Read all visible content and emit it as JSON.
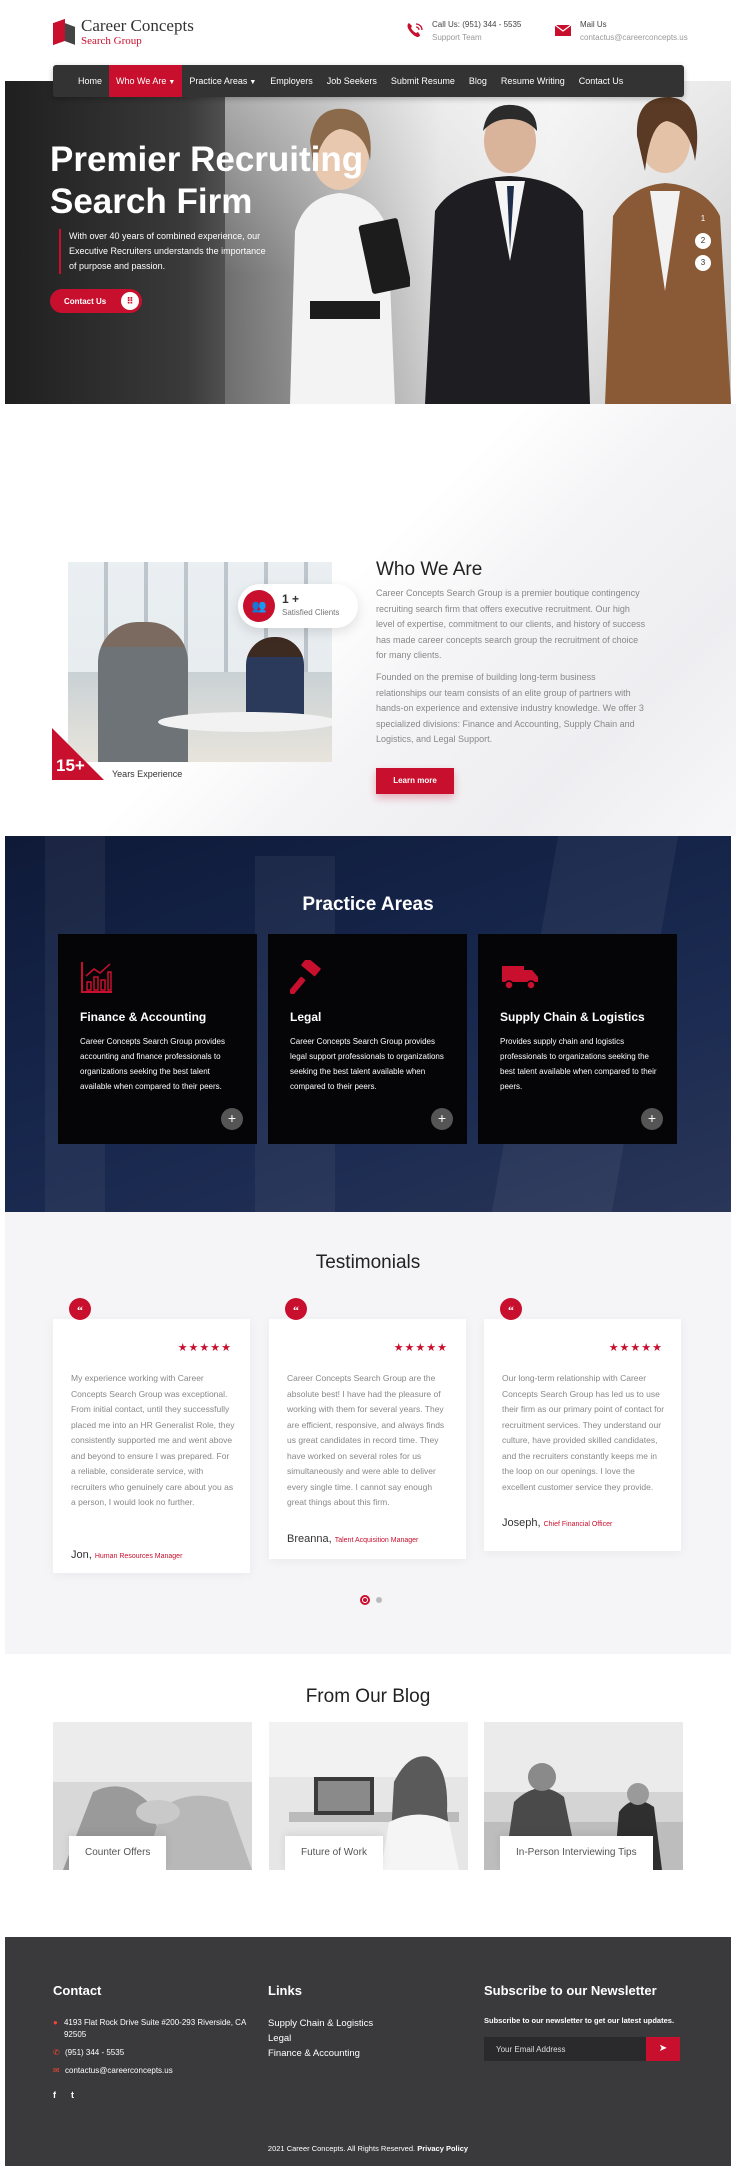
{
  "brand": {
    "name": "Career Concepts",
    "sub": "Search Group",
    "accent_color": "#c8102e",
    "dark_color": "#333333"
  },
  "header": {
    "call_label": "Call Us: (951) 344 - 5535",
    "call_sub": "Support Team",
    "mail_label": "Mail Us",
    "mail_sub": "contactus@careerconcepts.us"
  },
  "nav": {
    "items": [
      {
        "label": "Home"
      },
      {
        "label": "Who We Are",
        "dropdown": true,
        "active": true
      },
      {
        "label": "Practice Areas",
        "dropdown": true
      },
      {
        "label": "Employers"
      },
      {
        "label": "Job Seekers"
      },
      {
        "label": "Submit Resume"
      },
      {
        "label": "Blog"
      },
      {
        "label": "Resume Writing"
      },
      {
        "label": "Contact Us"
      }
    ]
  },
  "hero": {
    "title_line1": "Premier Recruiting",
    "title_line2": "Search Firm",
    "description": "With over 40 years of combined experience, our Executive Recruiters understands the importance of purpose and passion.",
    "button": "Contact Us",
    "slides": [
      "1",
      "2",
      "3"
    ]
  },
  "who": {
    "title": "Who We Are",
    "clients_count": "1 +",
    "clients_label": "Satisfied Clients",
    "experience_count": "15+",
    "experience_label": "Years Experience",
    "paragraph1": "Career Concepts Search Group is a premier boutique contingency recruiting search firm that offers executive recruitment. Our high level of expertise, commitment to our clients, and history of success has made career concepts search group the recruitment of choice for many clients.",
    "paragraph2": "Founded on the premise of building long-term business relationships our team consists of an elite group of partners with hands-on experience and extensive industry knowledge. We offer 3 specialized divisions: Finance and Accounting, Supply Chain and Logistics, and Legal Support.",
    "button": "Learn more"
  },
  "practice": {
    "title": "Practice Areas",
    "cards": [
      {
        "title": "Finance & Accounting",
        "icon": "chart-icon",
        "text": "Career Concepts Search Group provides accounting and finance professionals to organizations seeking the best talent available when compared to their peers."
      },
      {
        "title": "Legal",
        "icon": "gavel-icon",
        "text": "Career Concepts Search Group provides legal support professionals to organizations seeking the best talent available when compared to their peers."
      },
      {
        "title": "Supply Chain & Logistics",
        "icon": "truck-icon",
        "text": "Provides supply chain and logistics professionals to organizations seeking the best talent available when compared to their peers."
      }
    ]
  },
  "testimonials": {
    "title": "Testimonials",
    "stars": "★★★★★",
    "items": [
      {
        "text": "My experience working with Career Concepts Search Group was exceptional. From initial contact, until they successfully placed me into an HR Generalist Role, they consistently supported me and went above and beyond to ensure I was prepared. For a reliable, considerate service, with recruiters who genuinely care about you as a person, I would look no further.",
        "name": "Jon,",
        "role": "Human Resources Manager"
      },
      {
        "text": "Career Concepts Search Group are the absolute best! I have had the pleasure of working with them for several years. They are efficient, responsive, and always finds us great candidates in record time. They have worked on several roles for us simultaneously and were able to deliver every single time. I cannot say enough great things about this firm.",
        "name": "Breanna,",
        "role": "Talent Acquisition Manager"
      },
      {
        "text": "Our long-term relationship with Career Concepts Search Group has led us to use their firm as our primary point of contact for recruitment services. They understand our culture, have provided skilled candidates, and the recruiters constantly keeps me in the loop on our openings. I love the excellent customer service they provide.",
        "name": "Joseph,",
        "role": "Chief Financial Officer"
      }
    ]
  },
  "blog": {
    "title": "From Our Blog",
    "posts": [
      {
        "title": "Counter Offers"
      },
      {
        "title": "Future of Work"
      },
      {
        "title": "In-Person Interviewing Tips"
      }
    ]
  },
  "footer": {
    "contact_title": "Contact",
    "address": "4193 Flat Rock Drive Suite #200-293 Riverside, CA 92505",
    "phone": "(951) 344 - 5535",
    "email": "contactus@careerconcepts.us",
    "links_title": "Links",
    "links": [
      "Supply Chain & Logistics",
      "Legal",
      "Finance & Accounting"
    ],
    "newsletter_title": "Subscribe to our Newsletter",
    "newsletter_sub": "Subscribe to our newsletter to get our latest updates.",
    "newsletter_placeholder": "Your Email Address",
    "social": [
      "f",
      "t"
    ],
    "copyright": "2021 Career Concepts. All Rights Reserved.",
    "privacy": "Privacy Policy"
  }
}
